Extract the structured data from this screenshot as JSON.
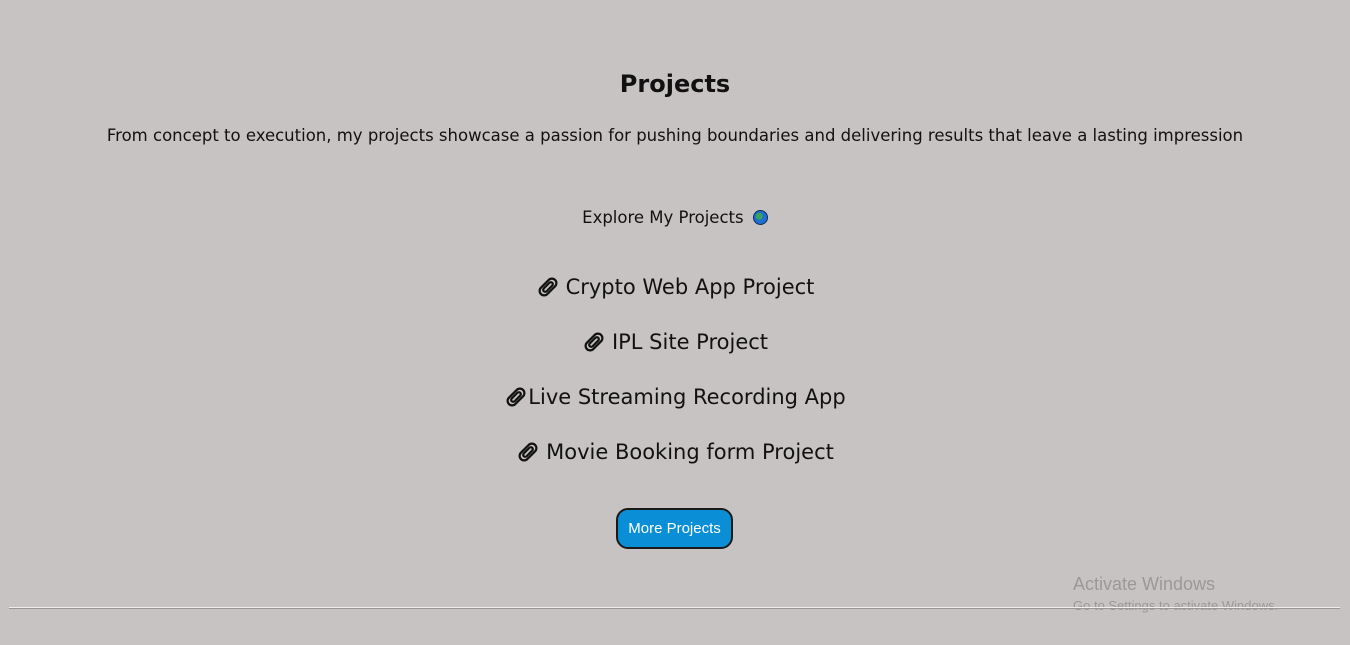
{
  "section": {
    "title": "Projects",
    "subtitle": "From concept to execution, my projects showcase a passion for pushing boundaries and delivering results that leave a lasting impression",
    "explore_label": "Explore My Projects",
    "explore_icon": "globe-icon"
  },
  "projects": [
    {
      "label": "Crypto Web App Project",
      "icon": "paperclip-icon"
    },
    {
      "label": "IPL Site Project",
      "icon": "paperclip-icon"
    },
    {
      "label": "Live Streaming Recording App",
      "icon": "paperclip-icon"
    },
    {
      "label": "Movie Booking form Project",
      "icon": "paperclip-icon"
    }
  ],
  "more_button": {
    "label": "More Projects",
    "color": "#0a8fd6"
  },
  "watermark": {
    "title": "Activate Windows",
    "subtitle": "Go to Settings to activate Windows."
  },
  "colors": {
    "background": "#c7c3c2",
    "text": "#111111"
  }
}
